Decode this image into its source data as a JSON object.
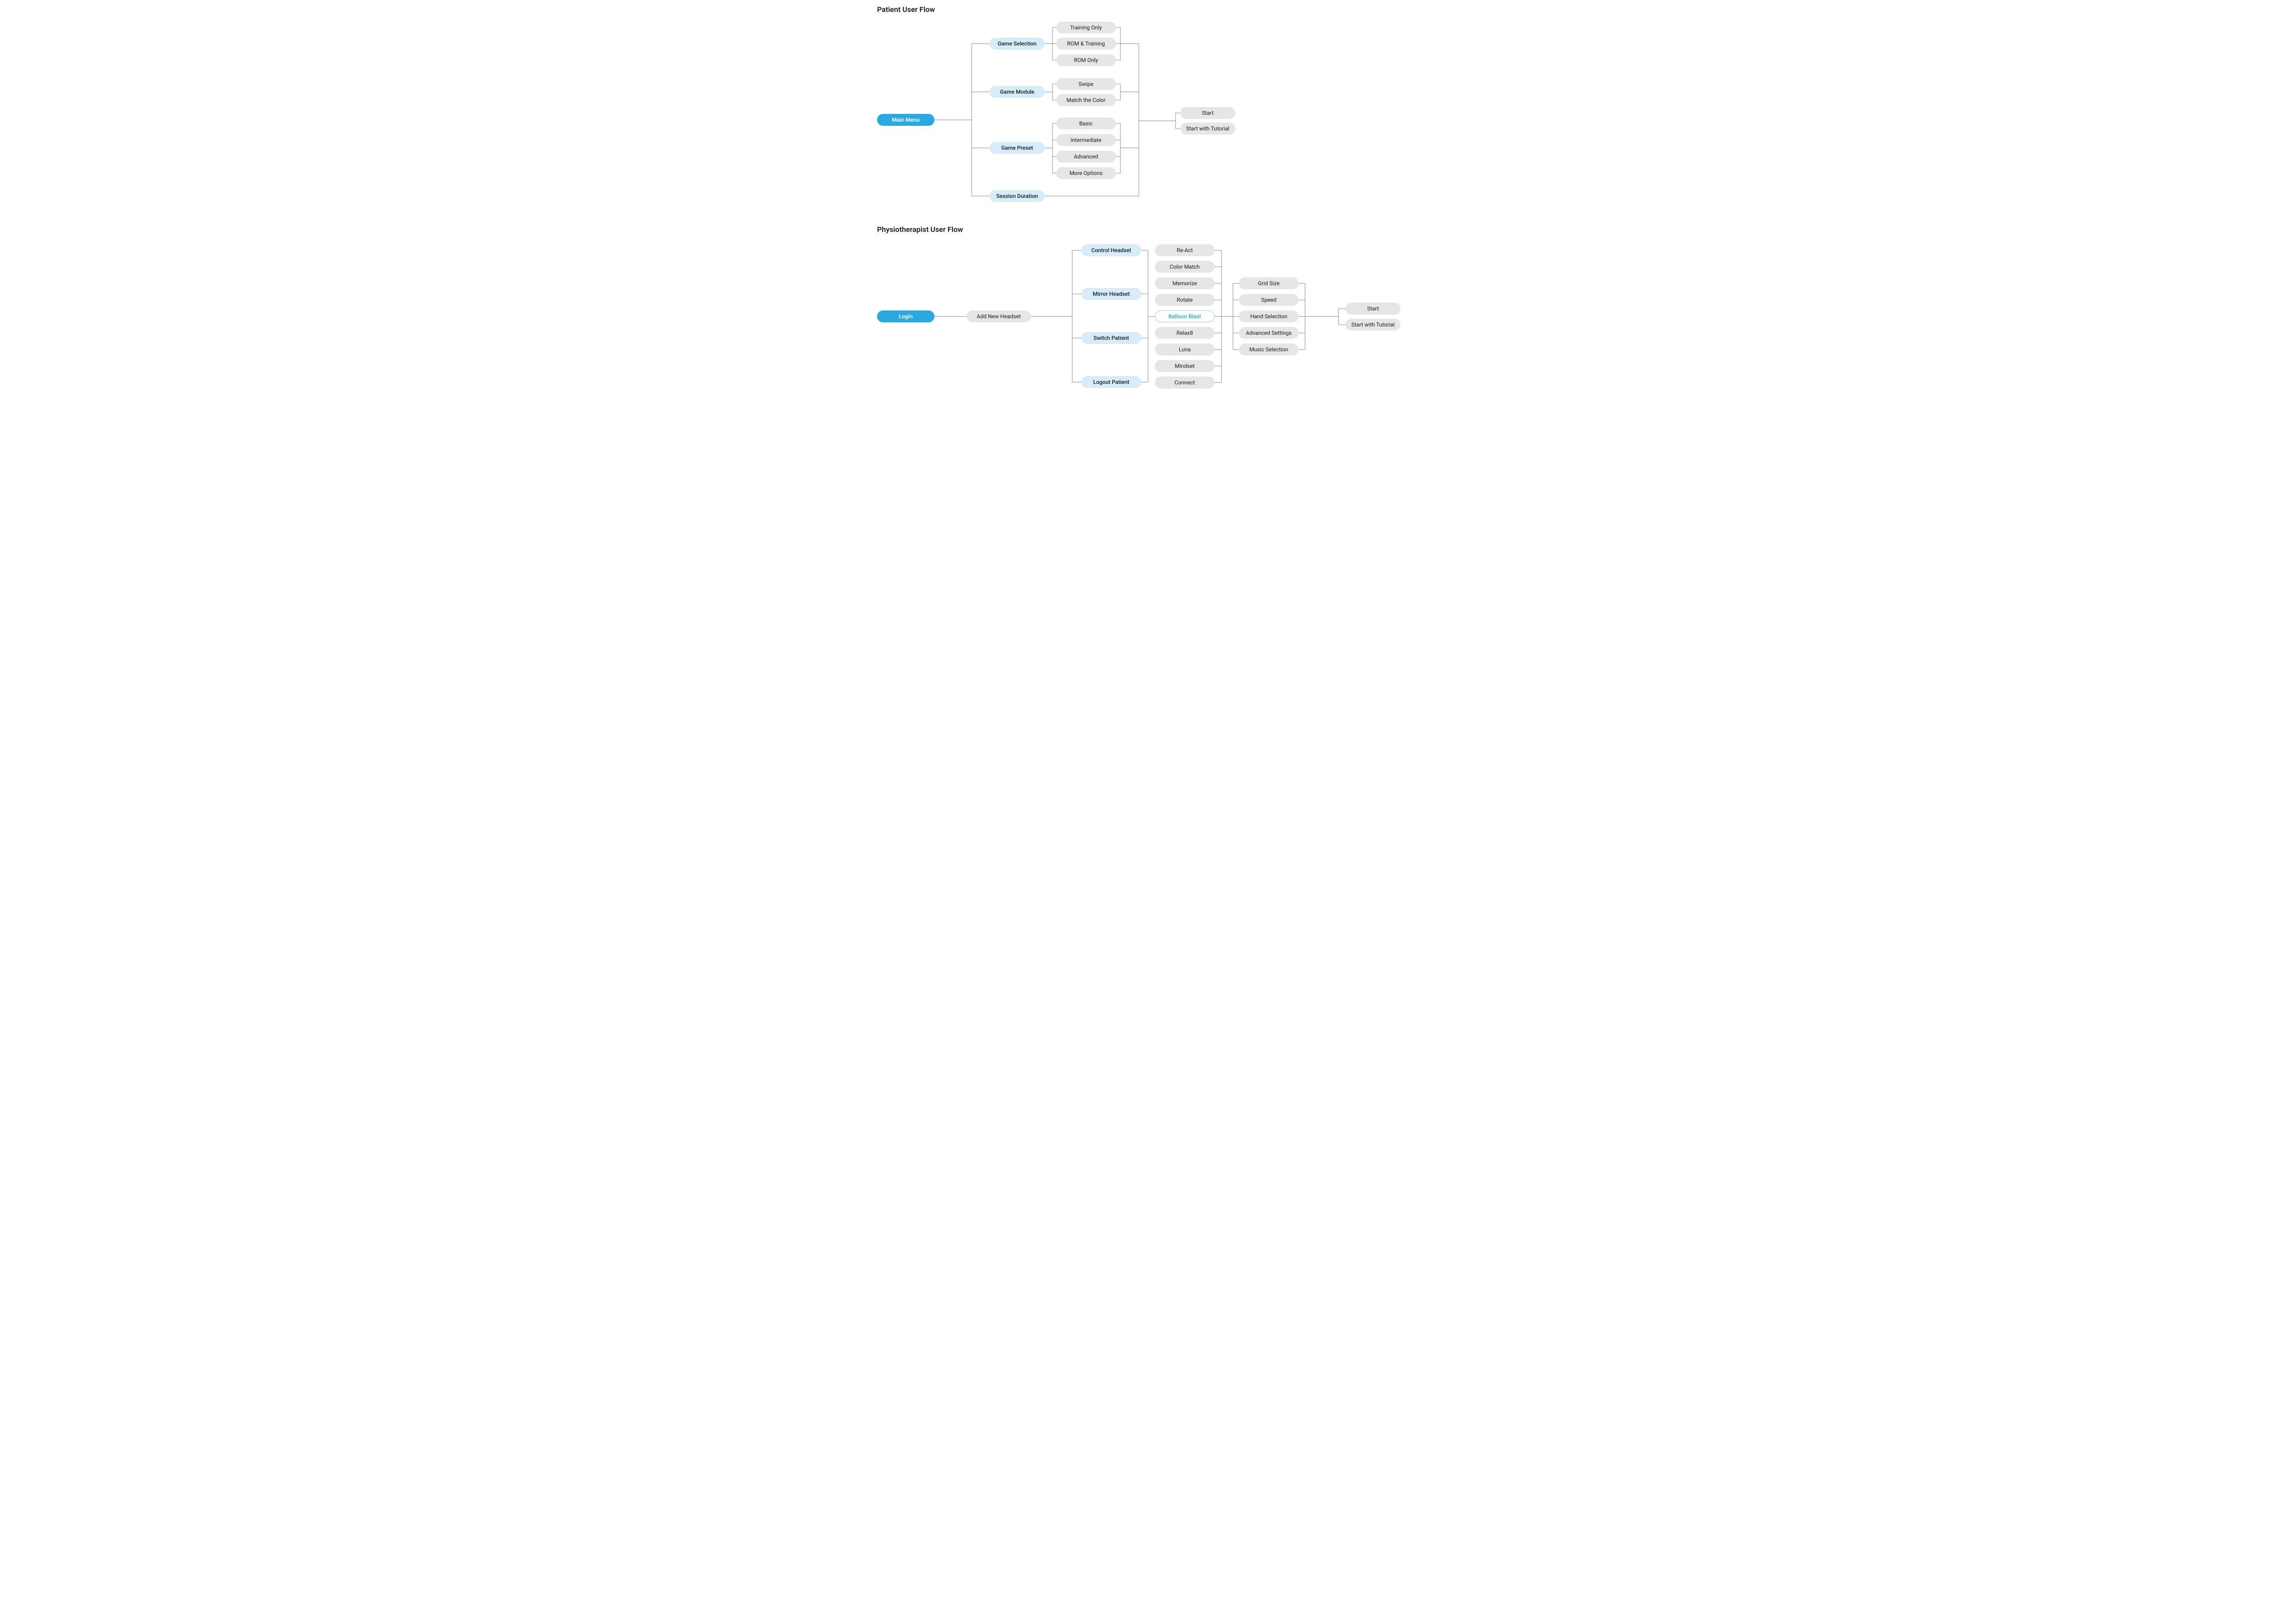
{
  "sections": {
    "patient": {
      "title": "Patient User Flow"
    },
    "physio": {
      "title": "Physiotherapist User Flow"
    }
  },
  "patient": {
    "root": "Main Menu",
    "categories": {
      "gameSelection": {
        "label": "Game Selection",
        "options": [
          "Training Only",
          "ROM & Training",
          "ROM Only"
        ]
      },
      "gameModule": {
        "label": "Game Module",
        "options": [
          "Swipe",
          "Match the Color"
        ]
      },
      "gamePreset": {
        "label": "Game Preset",
        "options": [
          "Basic",
          "intermediate",
          "Advanced",
          "More Options"
        ]
      },
      "sessionDuration": {
        "label": "Session Duration"
      }
    },
    "finals": [
      "Start",
      "Start with Tutorial"
    ]
  },
  "physio": {
    "root": "Login",
    "step1": "Add New Headset",
    "categories": [
      "Control Headset",
      "Mirror Headset",
      "Switch Patient",
      "Logout Patient"
    ],
    "games": [
      "Re-Act",
      "Color Match",
      "Memorize",
      "Rotate",
      "Balloon Blast",
      "Relax8",
      "Luna",
      "Mindset",
      "Connect"
    ],
    "selectedGame": "Balloon Blast",
    "settings": [
      "Grid Size",
      "Speed",
      "Hand Selection",
      "Advanced Settings",
      "Music Selection"
    ],
    "finals": [
      "Start",
      "Start with Tutorial"
    ]
  },
  "colors": {
    "primary": "#2aa9e0",
    "categoryBg": "#d6ecf9",
    "grayBg": "#e6e6e6",
    "outlineBorder": "#9fd6f0",
    "wire": "#8a8a8a"
  }
}
